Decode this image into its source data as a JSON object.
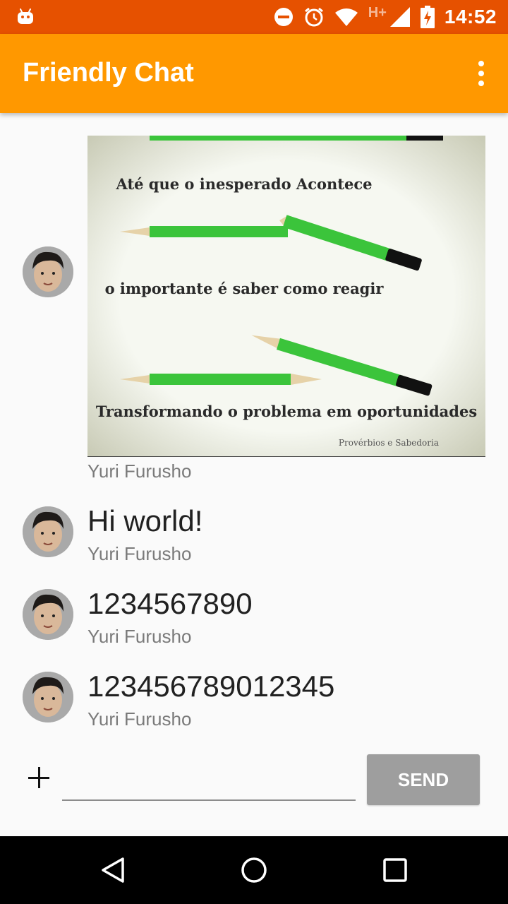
{
  "status_bar": {
    "time": "14:52",
    "network": "H+",
    "icons": [
      "android-debug-icon",
      "dnd-icon",
      "alarm-icon",
      "wifi-icon",
      "signal-icon",
      "battery-charging-icon"
    ]
  },
  "app_bar": {
    "title": "Friendly Chat",
    "menu_icon": "overflow-menu-icon"
  },
  "messages": [
    {
      "type": "image",
      "image_text": {
        "line1": "Até que o inesperado Acontece",
        "line2": "o importante é saber como reagir",
        "line3": "Transformando o problema em oportunidades",
        "credit": "Provérbios e Sabedoria"
      },
      "sender": "Yuri Furusho"
    },
    {
      "type": "text",
      "text": "Hi world!",
      "sender": "Yuri Furusho"
    },
    {
      "type": "text",
      "text": "1234567890",
      "sender": "Yuri Furusho"
    },
    {
      "type": "text",
      "text": "123456789012345",
      "sender": "Yuri Furusho"
    }
  ],
  "composer": {
    "add_icon": "plus-icon",
    "input_value": "",
    "send_label": "SEND"
  },
  "nav_bar": {
    "icons": [
      "back-icon",
      "home-icon",
      "recents-icon"
    ]
  },
  "colors": {
    "status_bar": "#e65100",
    "app_bar": "#ff9800",
    "send_disabled": "#9e9e9e"
  }
}
